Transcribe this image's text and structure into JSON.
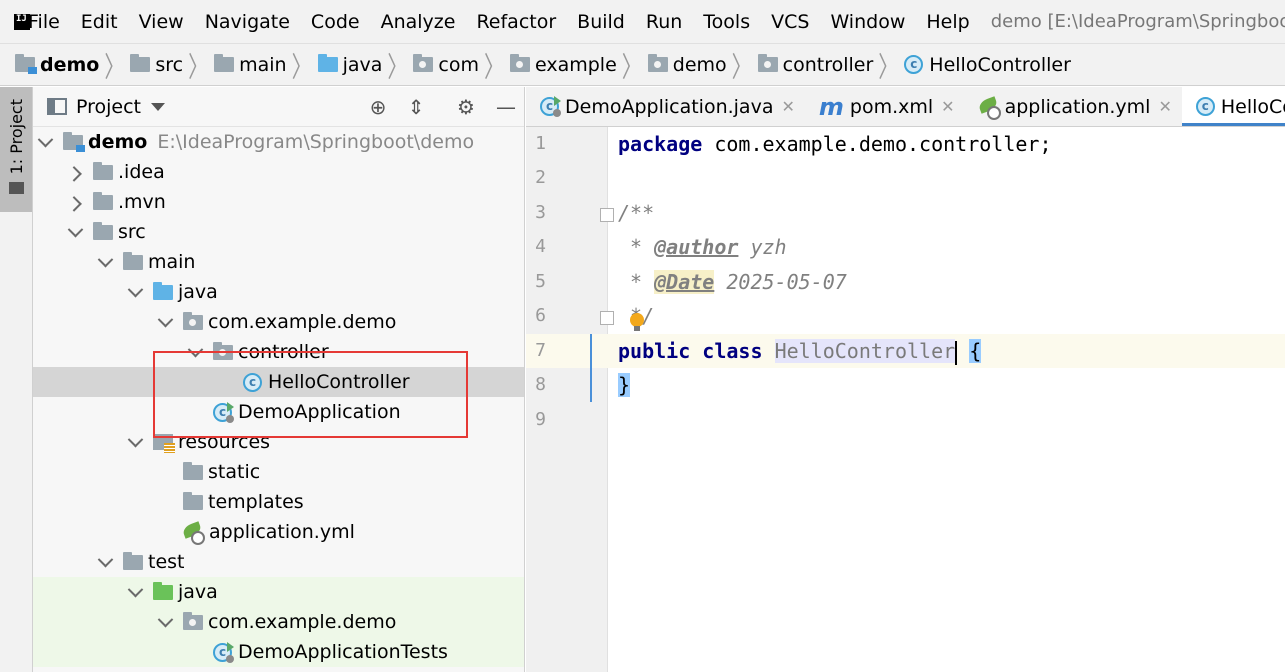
{
  "menu": {
    "items": [
      "File",
      "Edit",
      "View",
      "Navigate",
      "Code",
      "Analyze",
      "Refactor",
      "Build",
      "Run",
      "Tools",
      "VCS",
      "Window",
      "Help"
    ],
    "window_title": "demo [E:\\IdeaProgram\\Springboot\\demo"
  },
  "breadcrumb": {
    "items": [
      "demo",
      "src",
      "main",
      "java",
      "com",
      "example",
      "demo",
      "controller",
      "HelloController"
    ]
  },
  "toolstrip": {
    "project_tab": "1: Project"
  },
  "project_panel": {
    "title": "Project",
    "root": {
      "name": "demo",
      "path": "E:\\IdeaProgram\\Springboot\\demo"
    },
    "nodes": {
      "idea": ".idea",
      "mvn": ".mvn",
      "src": "src",
      "main": "main",
      "java": "java",
      "pkg": "com.example.demo",
      "controller": "controller",
      "hello": "HelloController",
      "demo_app": "DemoApplication",
      "resources": "resources",
      "static": "static",
      "templates": "templates",
      "app_yml": "application.yml",
      "test": "test",
      "test_java": "java",
      "test_pkg": "com.example.demo",
      "test_class": "DemoApplicationTests"
    }
  },
  "tabs": [
    {
      "label": "DemoApplication.java"
    },
    {
      "label": "pom.xml"
    },
    {
      "label": "application.yml"
    },
    {
      "label": "HelloControl"
    }
  ],
  "editor": {
    "line_numbers": [
      "1",
      "2",
      "3",
      "4",
      "5",
      "6",
      "7",
      "8",
      "9"
    ],
    "package_kw": "package",
    "package_name": " com.example.demo.controller;",
    "doc_open": "/**",
    "doc_star": " * ",
    "author_tag": "@author",
    "author_value": " yzh",
    "date_tag": "@Date",
    "date_value": " 2025-05-07",
    "doc_close": " */",
    "public_kw": "public",
    "class_kw": "class",
    "class_name": "HelloController",
    "open_brace": "{",
    "close_brace": "}"
  }
}
